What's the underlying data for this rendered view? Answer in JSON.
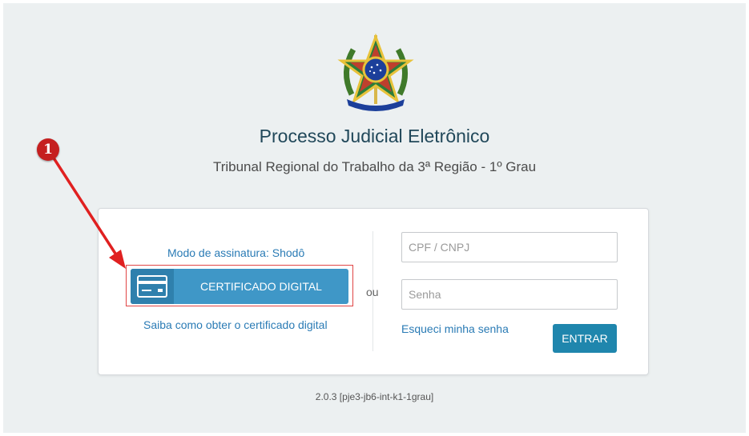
{
  "header": {
    "title": "Processo Judicial Eletrônico",
    "subtitle": "Tribunal Regional do Trabalho da 3ª Região - 1º Grau",
    "emblem_icon": "brazil-coat-of-arms-icon"
  },
  "certificate_panel": {
    "mode_link": "Modo de assinatura: Shodô",
    "button_label": "CERTIFICADO DIGITAL",
    "button_icon": "credit-card-icon",
    "obtain_link": "Saiba como obter o certificado digital"
  },
  "separator": {
    "or_label": "ou"
  },
  "login_panel": {
    "cpf_placeholder": "CPF / CNPJ",
    "cpf_value": "",
    "password_placeholder": "Senha",
    "password_value": "",
    "forgot_link": "Esqueci minha senha",
    "enter_button": "ENTRAR"
  },
  "footer": {
    "version": "2.0.3 [pje3-jb6-int-k1-1grau]"
  },
  "annotation": {
    "step_number": "1"
  },
  "colors": {
    "background": "#ecf0f1",
    "title": "#21485a",
    "link": "#2a7bb5",
    "cert_button": "#3f97c7",
    "enter_button": "#1f86ad",
    "annotation_red": "#c51f1f"
  }
}
